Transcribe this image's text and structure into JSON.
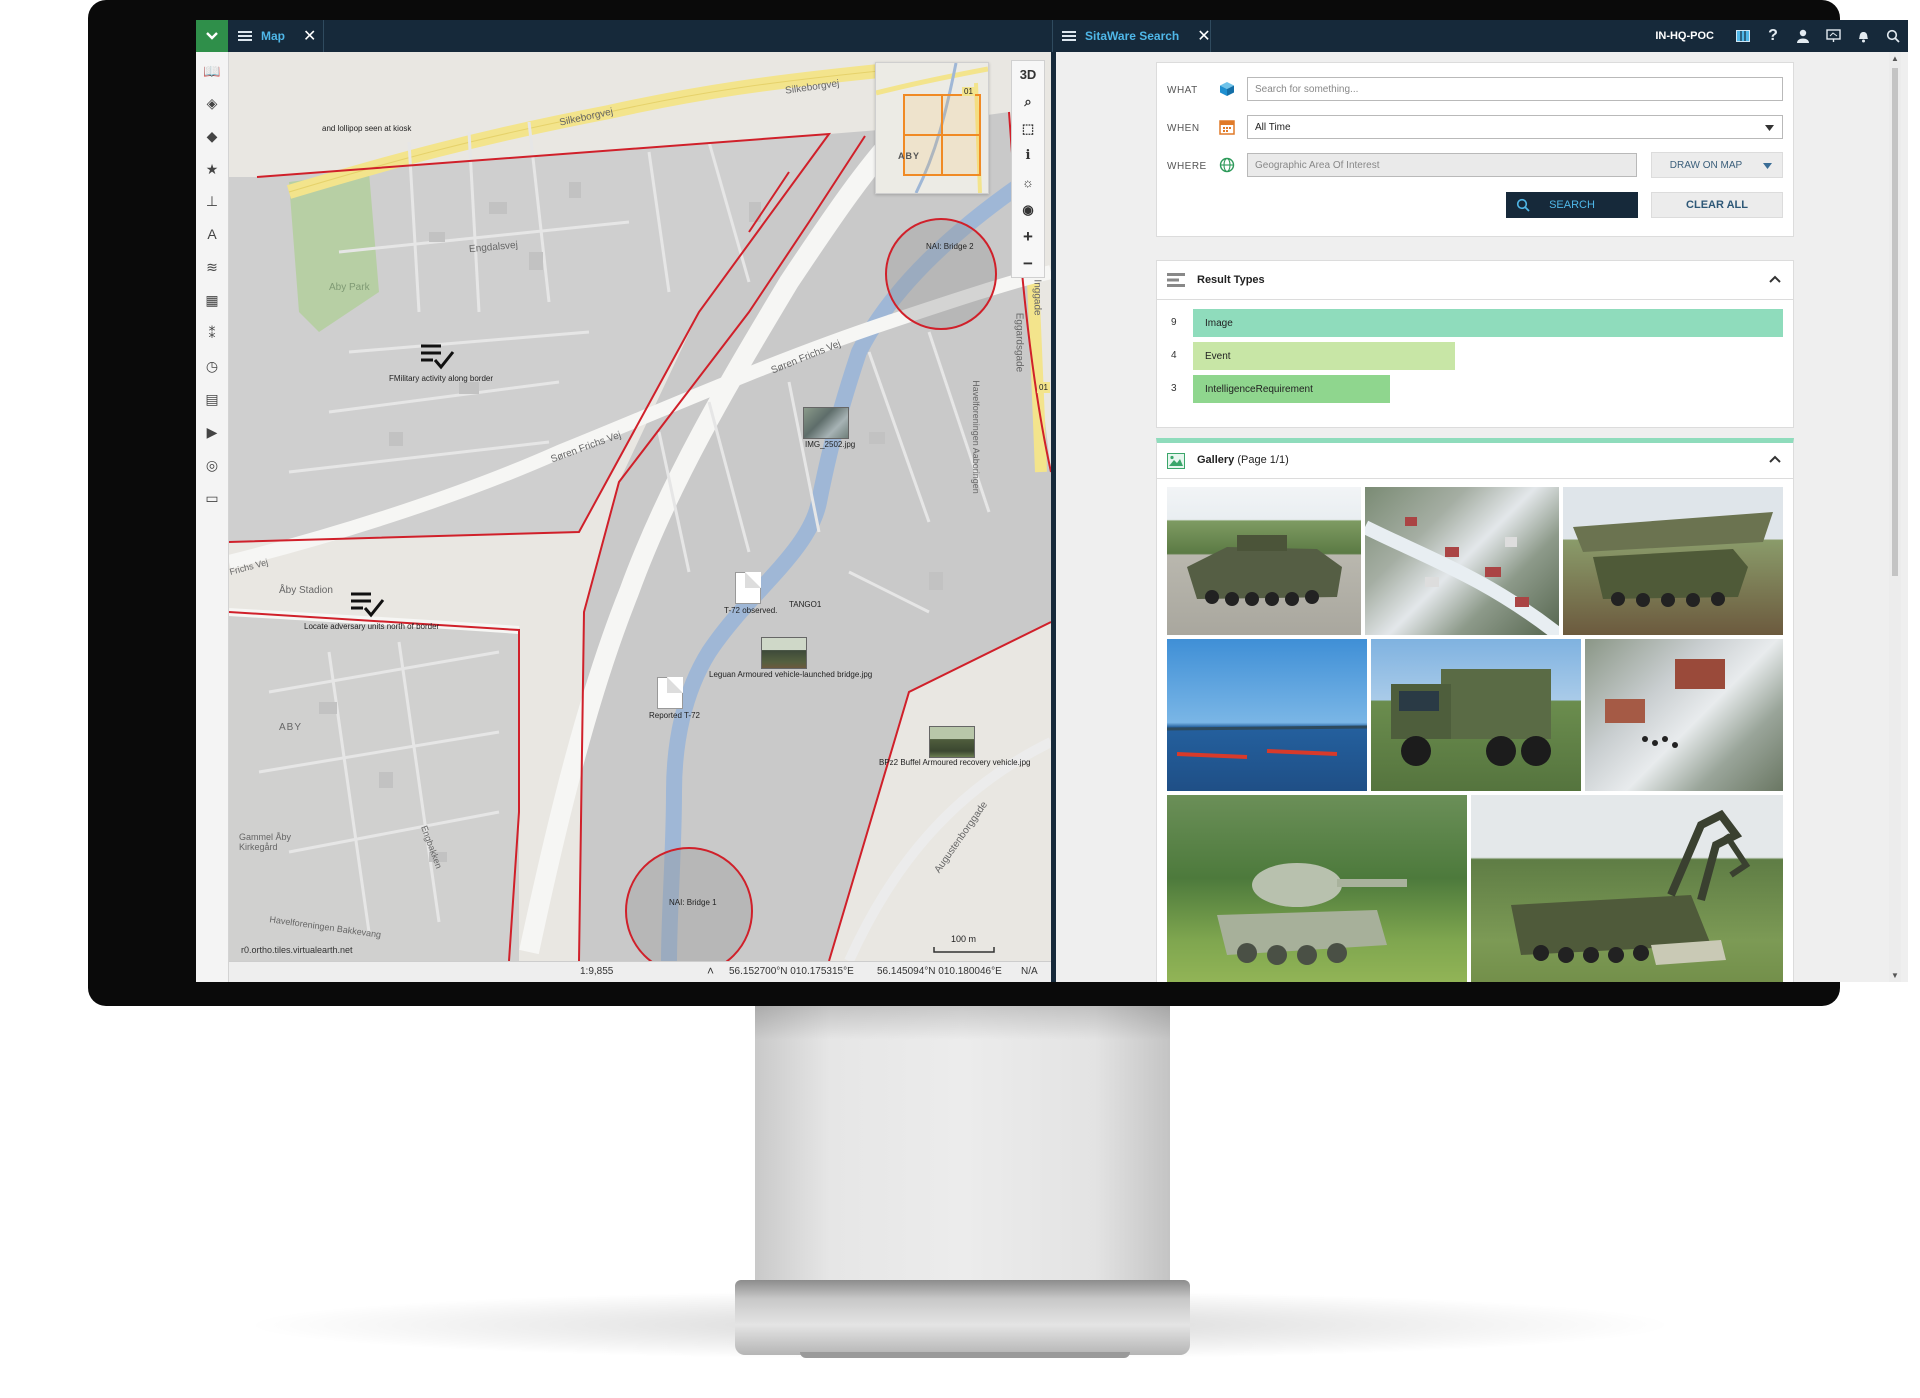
{
  "topbar": {
    "map_tab_label": "Map",
    "search_tab_label": "SitaWare Search",
    "close_glyph": "✕",
    "user_label": "IN-HQ-POC",
    "icons": [
      "layout-icon",
      "help-icon",
      "user-icon",
      "presentation-icon",
      "bell-icon",
      "search-icon"
    ]
  },
  "map": {
    "control_3d_label": "3D",
    "streets": [
      "Silkeborgvej",
      "Silkeborgvej",
      "Søren Frichs Vej",
      "Søren Frichs Vej",
      "Engdalsvej",
      "Eggardsgade",
      "Havelforeningen Aaboringen",
      "Augustenborggade",
      "Aby Park",
      "ABY",
      "Gammel Åby Kirkegård",
      "Havelforeningen Bakkevang",
      "Engbakken",
      "Åby Stadion",
      "Frichs Vej"
    ],
    "markers": {
      "lollipop": "and lollipop seen at kiosk",
      "military_activity": "FMilitary activity along border",
      "img_2502": "IMG_2502.jpg",
      "t72_observed": "T-72 observed.",
      "tango1": "TANGO1",
      "stadion": "Aby Stadion",
      "locate": "Locate adversary units north of border",
      "leguan": "Leguan Armoured vehicle-launched bridge.jpg",
      "reported": "Reported T-72",
      "bpz2": "BPz2 Buffel Armoured recovery vehicle.jpg",
      "nai_bridge2": "NAI: Bridge 2",
      "nai_bridge1": "NAI: Bridge 1",
      "tiles": "r0.ortho.tiles.virtualearth.net",
      "scale_bar": "100 m",
      "minimap_label": "ABY",
      "minimap_badge": "01",
      "edge_badge": "01",
      "edge_street": "Inggade"
    },
    "status": {
      "scale": "1:9,855",
      "coord1": "56.152700°N 010.175315°E",
      "coord2": "56.145094°N 010.180046°E",
      "na": "N/A"
    }
  },
  "search": {
    "what_label": "WHAT",
    "what_placeholder": "Search for something...",
    "when_label": "WHEN",
    "when_value": "All Time",
    "where_label": "WHERE",
    "where_placeholder": "Geographic Area Of Interest",
    "draw_on_map_label": "DRAW ON MAP",
    "search_button_label": "SEARCH",
    "clear_all_label": "CLEAR ALL"
  },
  "result_types": {
    "title": "Result Types",
    "rows": [
      {
        "count": "9",
        "label": "Image",
        "value": 9,
        "color": "#8fdcbc"
      },
      {
        "count": "4",
        "label": "Event",
        "value": 4,
        "color": "#c8e6a6"
      },
      {
        "count": "3",
        "label": "IntelligenceRequirement",
        "value": 3,
        "color": "#8fd68e"
      }
    ]
  },
  "gallery": {
    "title": "Gallery",
    "page_text": "(Page 1/1)"
  },
  "colors": {
    "topbar": "#16293a",
    "accent_green": "#2f8f4a",
    "tab_label": "#4fb7e8",
    "aoi_red": "#d0202a",
    "search_button": "#16293a"
  }
}
